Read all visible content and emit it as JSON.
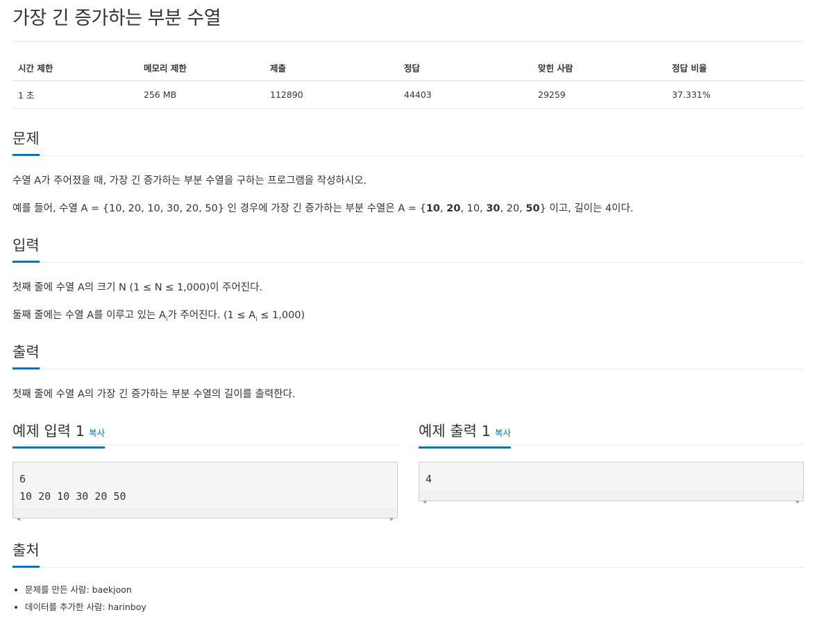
{
  "page_title": "가장 긴 증가하는 부분 수열",
  "info_table": {
    "headers": [
      "시간 제한",
      "메모리 제한",
      "제출",
      "정답",
      "맞힌 사람",
      "정답 비율"
    ],
    "values": [
      "1 초",
      "256 MB",
      "112890",
      "44403",
      "29259",
      "37.331%"
    ]
  },
  "sections": {
    "problem": {
      "title": "문제",
      "line1": "수열 A가 주어졌을 때, 가장 긴 증가하는 부분 수열을 구하는 프로그램을 작성하시오.",
      "line2_prefix": "예를 들어, 수열 A = {10, 20, 10, 30, 20, 50} 인 경우에 가장 긴 증가하는 부분 수열은 A = {",
      "b1": "10",
      "sep1": ", ",
      "b2": "20",
      "sep2": ", 10, ",
      "b3": "30",
      "sep3": ", 20, ",
      "b4": "50",
      "line2_suffix": "} 이고, 길이는 4이다."
    },
    "input": {
      "title": "입력",
      "line1": "첫째 줄에 수열 A의 크기 N (1 ≤ N ≤ 1,000)이 주어진다.",
      "line2_a": "둘째 줄에는 수열 A를 이루고 있는 A",
      "line2_sub": "i",
      "line2_b": "가 주어진다. (1 ≤ A",
      "line2_sub2": "i",
      "line2_c": " ≤ 1,000)"
    },
    "output": {
      "title": "출력",
      "line1": "첫째 줄에 수열 A의 가장 긴 증가하는 부분 수열의 길이를 출력한다."
    },
    "source": {
      "title": "출처",
      "items": [
        {
          "label": "문제를 만든 사람: ",
          "value": "baekjoon"
        },
        {
          "label": "데이터를 추가한 사람: ",
          "value": "harinboy"
        }
      ]
    }
  },
  "examples": {
    "input": {
      "title": "예제 입력 1",
      "copy": "복사",
      "text": "6\n10 20 10 30 20 50"
    },
    "output": {
      "title": "예제 출력 1",
      "copy": "복사",
      "text": "4"
    }
  }
}
